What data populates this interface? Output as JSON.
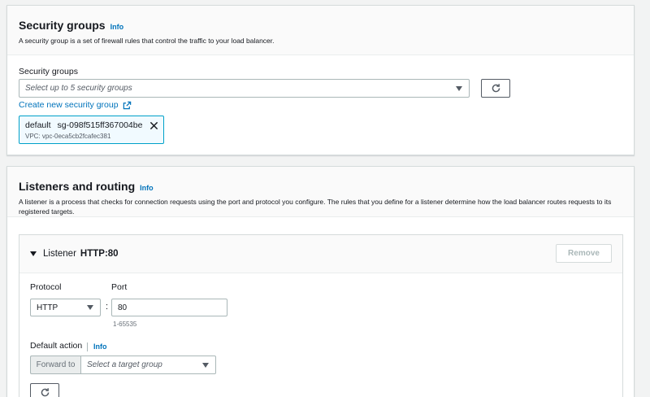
{
  "security": {
    "title": "Security groups",
    "info": "Info",
    "description": "A security group is a set of firewall rules that control the traffic to your load balancer.",
    "field_label": "Security groups",
    "select_placeholder": "Select up to 5 security groups",
    "create_link": "Create new security group",
    "token": {
      "name": "default",
      "id": "sg-098f515ff367004be",
      "vpc": "VPC: vpc-0eca5cb2fcafec381"
    }
  },
  "listeners": {
    "title": "Listeners and routing",
    "info": "Info",
    "description": "A listener is a process that checks for connection requests using the port and protocol you configure. The rules that you define for a listener determine how the load balancer routes requests to its registered targets.",
    "listener": {
      "label": "Listener",
      "port_label": "HTTP:80",
      "remove_button": "Remove",
      "protocol_label": "Protocol",
      "protocol_value": "HTTP",
      "port_field_label": "Port",
      "port_value": "80",
      "port_hint": "1-65535",
      "colon": ":",
      "default_action_label": "Default action",
      "default_action_info": "Info",
      "forward_to": "Forward to",
      "target_placeholder": "Select a target group"
    }
  },
  "icons": [
    "refresh-icon",
    "external-link-icon",
    "close-icon",
    "caret-down-icon",
    "expand-triangle-icon"
  ],
  "colors": {
    "link": "#0073bb",
    "token_bg": "#f1faff",
    "token_border": "#00a1c9",
    "page_bg": "#f2f3f3"
  }
}
